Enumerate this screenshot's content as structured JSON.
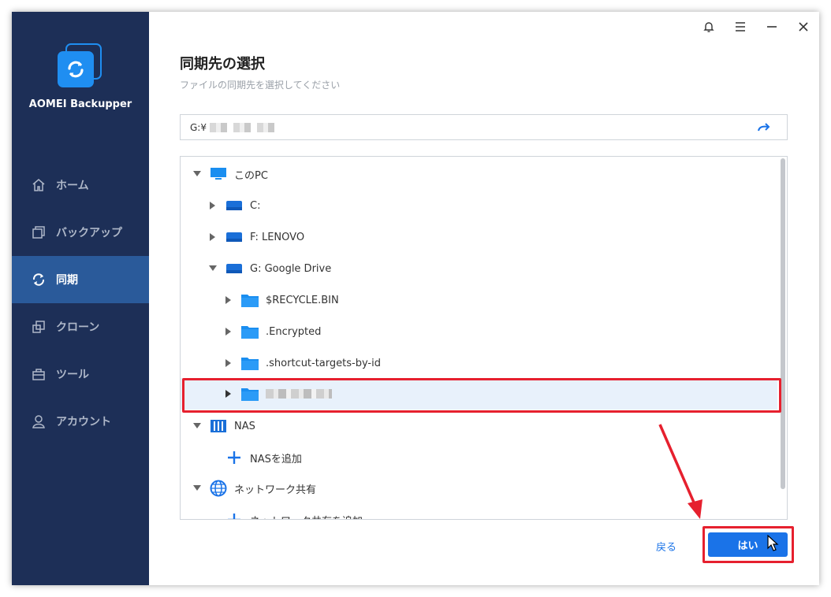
{
  "app": {
    "name": "AOMEI Backupper"
  },
  "sidebar": {
    "items": [
      {
        "label": "ホーム",
        "icon": "home-icon",
        "active": false
      },
      {
        "label": "バックアップ",
        "icon": "backup-icon",
        "active": false
      },
      {
        "label": "同期",
        "icon": "sync-icon",
        "active": true
      },
      {
        "label": "クローン",
        "icon": "clone-icon",
        "active": false
      },
      {
        "label": "ツール",
        "icon": "tools-icon",
        "active": false
      },
      {
        "label": "アカウント",
        "icon": "account-icon",
        "active": false
      }
    ]
  },
  "header": {
    "title": "同期先の選択",
    "subtitle": "ファイルの同期先を選択してください"
  },
  "path": {
    "value": "G:¥"
  },
  "tree": {
    "this_pc": "このPC",
    "drive_c": "C:",
    "drive_f": "F: LENOVO",
    "drive_g": "G: Google Drive",
    "folder_recycle": "$RECYCLE.BIN",
    "folder_encrypted": ".Encrypted",
    "folder_shortcut": ".shortcut-targets-by-id",
    "nas": "NAS",
    "add_nas": "NASを追加",
    "network_share": "ネットワーク共有",
    "add_network_share": "ネットワーク共有を追加"
  },
  "footer": {
    "back_label": "戻る",
    "yes_label": "はい"
  },
  "colors": {
    "sidebar_bg": "#1d2f57",
    "sidebar_active": "#2a5a9a",
    "accent": "#1a73e8",
    "highlight_red": "#e6202e",
    "selected_row": "#e8f1fb"
  }
}
